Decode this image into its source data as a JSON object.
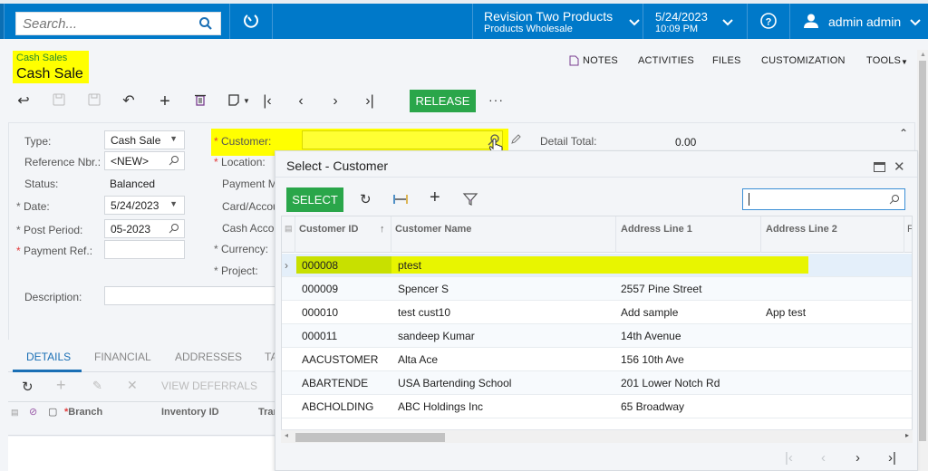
{
  "topbar": {
    "search_placeholder": "Search...",
    "company_name": "Revision Two Products",
    "branch_name": "Products Wholesale",
    "date": "5/24/2023",
    "time": "10:09 PM",
    "user": "admin admin"
  },
  "page": {
    "breadcrumb": "Cash Sales",
    "title": "Cash Sale",
    "highlight_color": "#ffff00"
  },
  "top_links": {
    "notes": "NOTES",
    "activities": "ACTIVITIES",
    "files": "FILES",
    "customization": "CUSTOMIZATION",
    "tools": "TOOLS"
  },
  "toolbar": {
    "release": "RELEASE",
    "more": "···"
  },
  "form": {
    "type_label": "Type:",
    "type_value": "Cash Sale",
    "ref_label": "Reference Nbr.:",
    "ref_value": "<NEW>",
    "status_label": "Status:",
    "status_value": "Balanced",
    "date_label": "Date:",
    "date_value": "5/24/2023",
    "post_period_label": "Post Period:",
    "post_period_value": "05-2023",
    "payment_ref_label": "Payment Ref.:",
    "payment_ref_value": "",
    "description_label": "Description:",
    "description_value": "",
    "customer_label": "Customer:",
    "customer_value": "",
    "location_label": "Location:",
    "payment_method_label": "Payment M",
    "card_account_label": "Card/Accou",
    "cash_account_label": "Cash Accou",
    "currency_label": "Currency:",
    "project_label": "Project:",
    "detail_total_label": "Detail Total:",
    "detail_total_value": "0.00"
  },
  "tabs": [
    {
      "label": "DETAILS",
      "active": true
    },
    {
      "label": "FINANCIAL",
      "active": false
    },
    {
      "label": "ADDRESSES",
      "active": false
    },
    {
      "label": "TA",
      "active": false
    }
  ],
  "details_toolbar": {
    "view_deferrals": "VIEW DEFERRALS"
  },
  "details_grid": {
    "columns": [
      "Branch",
      "Inventory ID",
      "Trar"
    ]
  },
  "dialog": {
    "title": "Select - Customer",
    "select_label": "SELECT",
    "search_value": "",
    "columns": [
      "Customer ID",
      "Customer Name",
      "Address Line 1",
      "Address Line 2",
      "F"
    ],
    "rows": [
      {
        "id": "000008",
        "name": "ptest",
        "addr1": "",
        "addr2": "",
        "selected": true
      },
      {
        "id": "000009",
        "name": "Spencer S",
        "addr1": "2557 Pine Street",
        "addr2": ""
      },
      {
        "id": "000010",
        "name": "test cust10",
        "addr1": "Add sample",
        "addr2": "App test"
      },
      {
        "id": "000011",
        "name": "sandeep Kumar",
        "addr1": "14th Avenue",
        "addr2": ""
      },
      {
        "id": "AACUSTOMER",
        "name": "Alta Ace",
        "addr1": "156 10th Ave",
        "addr2": ""
      },
      {
        "id": "ABARTENDE",
        "name": "USA Bartending School",
        "addr1": "201 Lower Notch Rd",
        "addr2": ""
      },
      {
        "id": "ABCHOLDING",
        "name": "ABC Holdings Inc",
        "addr1": "65 Broadway",
        "addr2": ""
      }
    ]
  }
}
